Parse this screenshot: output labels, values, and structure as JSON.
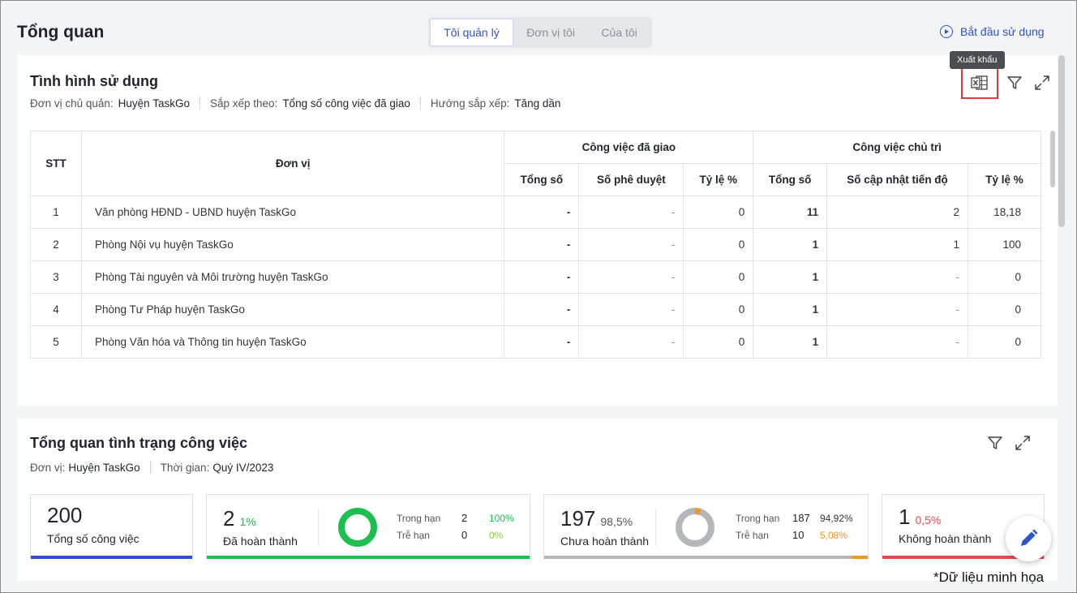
{
  "header": {
    "title": "Tổng quan",
    "tabs": [
      {
        "label": "Tôi quản lý",
        "active": true
      },
      {
        "label": "Đơn vị tôi",
        "active": false
      },
      {
        "label": "Của tôi",
        "active": false
      }
    ],
    "start_label": "Bắt đầu sử dụng"
  },
  "usage": {
    "title": "Tình hình sử dụng",
    "tooltip": "Xuất khẩu",
    "filters": [
      {
        "label": "Đơn vị chủ quản:",
        "value": "Huyện TaskGo"
      },
      {
        "label": "Sắp xếp theo:",
        "value": "Tổng số công việc đã giao"
      },
      {
        "label": "Hướng sắp xếp:",
        "value": "Tăng dần"
      }
    ],
    "table": {
      "h_stt": "STT",
      "h_unit": "Đơn vị",
      "h_assigned": "Công việc đã giao",
      "h_lead": "Công việc chủ trì",
      "sub_headers": [
        "Tổng số",
        "Số phê duyệt",
        "Tỷ lệ %",
        "Tổng số",
        "Số cập nhật tiến độ",
        "Tỷ lệ %"
      ],
      "rows": [
        [
          "1",
          "Văn phòng HĐND - UBND huyện TaskGo",
          "-",
          "-",
          "0",
          "11",
          "2",
          "18,18"
        ],
        [
          "2",
          "Phòng Nội vụ huyện TaskGo",
          "-",
          "-",
          "0",
          "1",
          "1",
          "100"
        ],
        [
          "3",
          "Phòng Tài nguyên và Môi trường huyện TaskGo",
          "-",
          "-",
          "0",
          "1",
          "-",
          "0"
        ],
        [
          "4",
          "Phòng Tư Pháp huyện TaskGo",
          "-",
          "-",
          "0",
          "1",
          "-",
          "0"
        ],
        [
          "5",
          "Phòng Văn hóa và Thông tin huyện TaskGo",
          "-",
          "-",
          "0",
          "1",
          "-",
          "0"
        ]
      ]
    }
  },
  "overview": {
    "title": "Tổng quan tình trạng công việc",
    "filters": [
      {
        "label": "Đơn vị:",
        "value": "Huyện TaskGo"
      },
      {
        "label": "Thời gian:",
        "value": "Quý IV/2023"
      }
    ],
    "total": {
      "value": "200",
      "label": "Tổng số công việc",
      "color": "#2f4fd6"
    },
    "done": {
      "value": "2",
      "pct": "1%",
      "label": "Đã hoàn thành",
      "color": "#1dbf4e",
      "on_time_label": "Trong hạn",
      "on_time": "2",
      "on_time_pct": "100%",
      "late_label": "Trễ hạn",
      "late": "0",
      "late_pct": "0%",
      "on_time_fraction": 1.0
    },
    "not_done": {
      "value": "197",
      "pct": "98,5%",
      "label": "Chưa hoàn thành",
      "color": "#b4b6ba",
      "on_time_label": "Trong hạn",
      "on_time": "187",
      "on_time_pct": "94,92%",
      "late_label": "Trễ hạn",
      "late": "10",
      "late_pct": "5,08%",
      "late_color": "#f5962a",
      "late_fraction": 0.0508
    },
    "failed": {
      "value": "1",
      "pct": "0,5%",
      "label": "Không hoàn thành",
      "color": "#e84a4a"
    }
  },
  "watermark": "*Dữ liệu minh họa",
  "colors": {
    "accent": "#2f54c8",
    "highlight": "#e0393e"
  }
}
